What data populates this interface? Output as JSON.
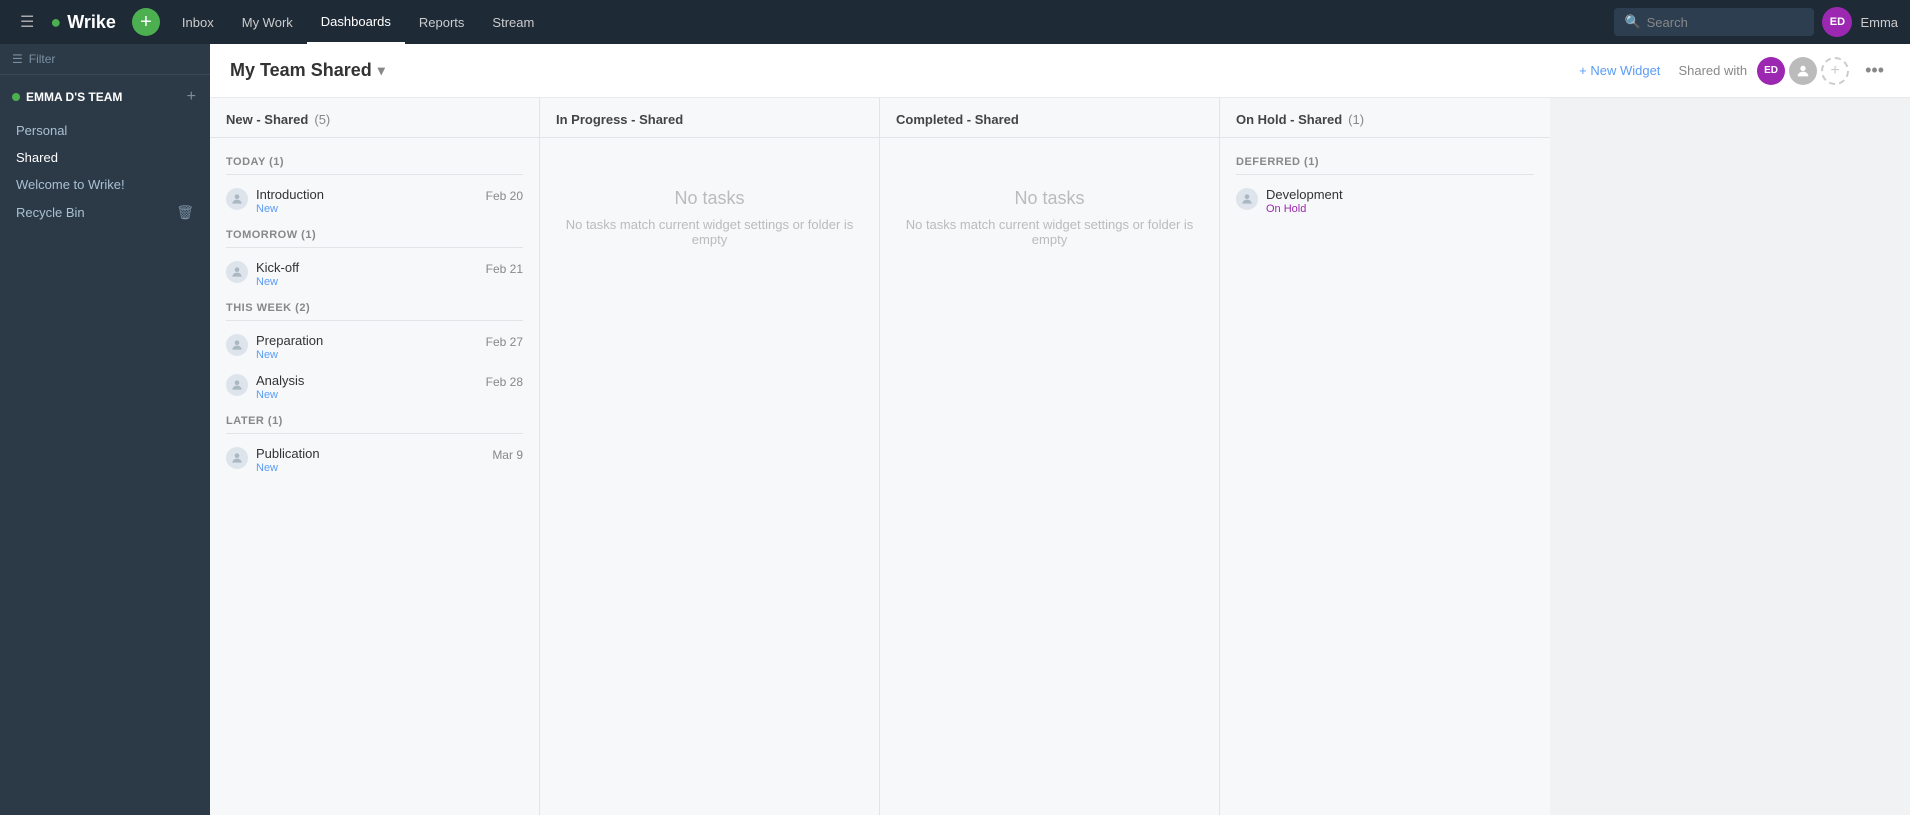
{
  "app": {
    "logo": "Wrike"
  },
  "topnav": {
    "hamburger": "☰",
    "add_label": "+",
    "links": [
      {
        "id": "inbox",
        "label": "Inbox",
        "active": false
      },
      {
        "id": "mywork",
        "label": "My Work",
        "active": false
      },
      {
        "id": "dashboards",
        "label": "Dashboards",
        "active": true
      },
      {
        "id": "reports",
        "label": "Reports",
        "active": false
      },
      {
        "id": "stream",
        "label": "Stream",
        "active": false
      }
    ],
    "search_placeholder": "Search",
    "user_initials": "ED",
    "user_name": "Emma",
    "user_avatar_color": "#9c27b0"
  },
  "sidebar": {
    "filter_placeholder": "Filter",
    "team_name": "EMMA D'S TEAM",
    "items": [
      {
        "id": "personal",
        "label": "Personal"
      },
      {
        "id": "shared",
        "label": "Shared"
      },
      {
        "id": "welcome",
        "label": "Welcome to Wrike!"
      },
      {
        "id": "recycle",
        "label": "Recycle Bin",
        "has_trash": true
      }
    ]
  },
  "header": {
    "title": "My Team Shared",
    "caret": "▾",
    "add_widget_label": "+ New Widget",
    "shared_with_label": "Shared with",
    "add_avatar_icon": "+",
    "more_icon": "•••",
    "user_initials": "ED",
    "user_avatar_color": "#9c27b0"
  },
  "columns": [
    {
      "id": "new-shared",
      "title": "New - Shared",
      "count": 5,
      "groups": [
        {
          "label": "TODAY (1)",
          "tasks": [
            {
              "name": "Introduction",
              "status": "New",
              "date": "Feb 20"
            }
          ]
        },
        {
          "label": "TOMORROW (1)",
          "tasks": [
            {
              "name": "Kick-off",
              "status": "New",
              "date": "Feb 21"
            }
          ]
        },
        {
          "label": "THIS WEEK (2)",
          "tasks": [
            {
              "name": "Preparation",
              "status": "New",
              "date": "Feb 27"
            },
            {
              "name": "Analysis",
              "status": "New",
              "date": "Feb 28"
            }
          ]
        },
        {
          "label": "LATER (1)",
          "tasks": [
            {
              "name": "Publication",
              "status": "New",
              "date": "Mar 9"
            }
          ]
        }
      ],
      "empty": false
    },
    {
      "id": "in-progress",
      "title": "In Progress - Shared",
      "count": null,
      "groups": [],
      "empty": true,
      "empty_title": "No tasks",
      "empty_sub": "No tasks match current widget settings or folder is empty"
    },
    {
      "id": "completed",
      "title": "Completed - Shared",
      "count": null,
      "groups": [],
      "empty": true,
      "empty_title": "No tasks",
      "empty_sub": "No tasks match current widget settings or folder is empty"
    },
    {
      "id": "on-hold",
      "title": "On Hold - Shared",
      "count": 1,
      "groups": [
        {
          "label": "DEFERRED (1)",
          "tasks": [
            {
              "name": "Development",
              "status": "On Hold",
              "date": null,
              "status_class": "on-hold"
            }
          ]
        }
      ],
      "empty": false
    }
  ]
}
